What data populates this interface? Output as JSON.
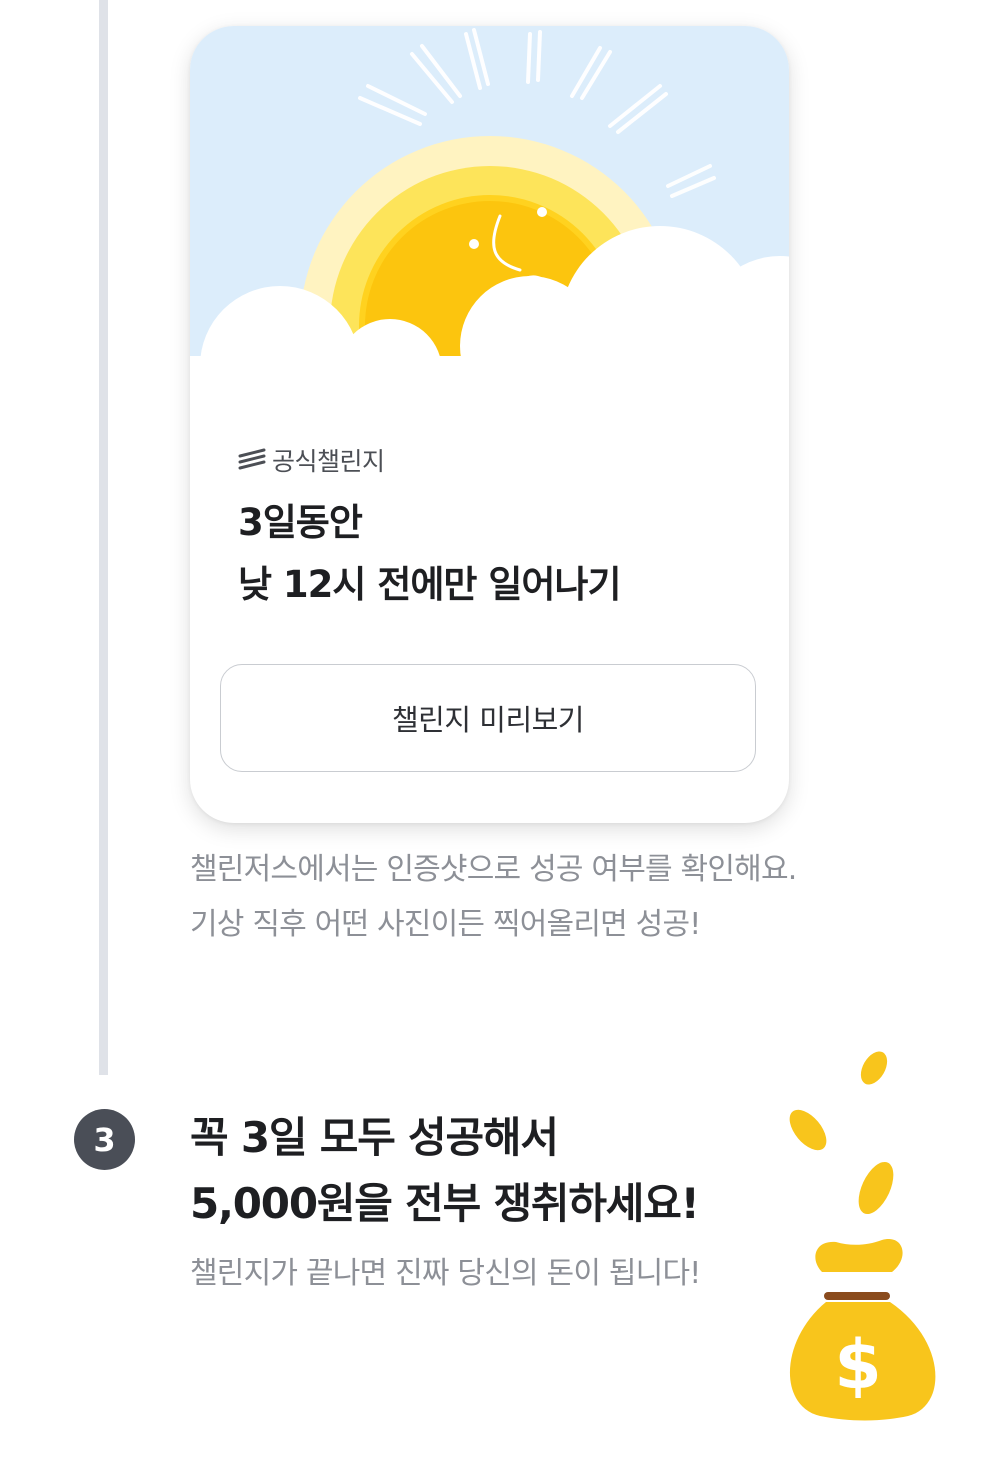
{
  "card": {
    "badge_label": "공식챌린지",
    "title_line1": "3일동안",
    "title_line2": "낮 12시 전에만 일어나기",
    "preview_button_label": "챌린지 미리보기"
  },
  "description": {
    "line1": "챌린저스에서는 인증샷으로 성공 여부를 확인해요.",
    "line2": "기상 직후 어떤 사진이든 찍어올리면 성공!"
  },
  "step3": {
    "number": "3",
    "title_line1": "꼭 3일 모두 성공해서",
    "title_line2": "5,000원을 전부 쟁취하세요!",
    "subtitle": "챌린지가 끝나면 진짜 당신의 돈이 됩니다!"
  },
  "colors": {
    "sky": "#dcedfb",
    "sun": "#fcc50e",
    "sun_glow": "#fde45a",
    "gold": "#f8c51c",
    "timeline": "#dfe2e8",
    "step_badge": "#4a4e57"
  },
  "icons": {
    "badge": "stripes-logo-icon",
    "illustration": "sun-behind-clouds-illustration",
    "money": "money-bag-icon"
  }
}
